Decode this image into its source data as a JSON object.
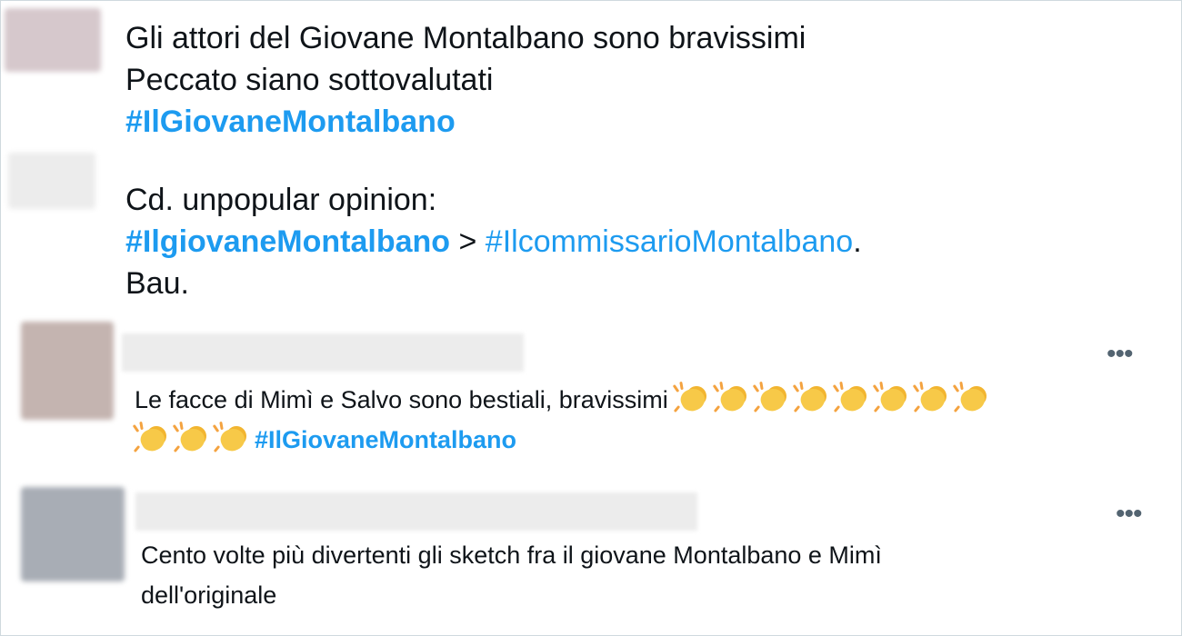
{
  "tweets": [
    {
      "lines": [
        [
          {
            "text": "Gli attori del Giovane Montalbano sono bravissimi",
            "kind": "text"
          }
        ],
        [
          {
            "text": "Peccato siano sottovalutati",
            "kind": "text"
          }
        ],
        [
          {
            "text": "#IlGiovaneMontalbano",
            "kind": "tag"
          }
        ]
      ]
    },
    {
      "lines": [
        [
          {
            "text": "Cd. unpopular opinion:",
            "kind": "text"
          }
        ],
        [
          {
            "text": "#IlgiovaneMontalbano",
            "kind": "tag"
          },
          {
            "text": " > ",
            "kind": "text"
          },
          {
            "text": "#IlcommissarioMontalbano",
            "kind": "link"
          },
          {
            "text": ".",
            "kind": "text"
          }
        ],
        [
          {
            "text": "Bau.",
            "kind": "text"
          }
        ]
      ]
    },
    {
      "more_label": "•••",
      "lines": [
        [
          {
            "text": "Le facce di Mimì e Salvo sono bestiali, bravissimi ",
            "kind": "text"
          },
          {
            "kind": "clap",
            "count": 8
          }
        ],
        [
          {
            "kind": "clap",
            "count": 3
          },
          {
            "text": "#IlGiovaneMontalbano",
            "kind": "tag"
          }
        ]
      ]
    },
    {
      "more_label": "•••",
      "lines": [
        [
          {
            "text": "Cento volte più divertenti gli sketch fra il giovane Montalbano e Mimì",
            "kind": "text"
          }
        ],
        [
          {
            "text": "dell'originale",
            "kind": "text"
          }
        ]
      ]
    }
  ],
  "icons": {
    "clap": "clapping-hands-icon",
    "more": "more-options-icon"
  },
  "colors": {
    "hashtag": "#1d9bf0",
    "text": "#0f1419",
    "more_icon": "#536471"
  }
}
